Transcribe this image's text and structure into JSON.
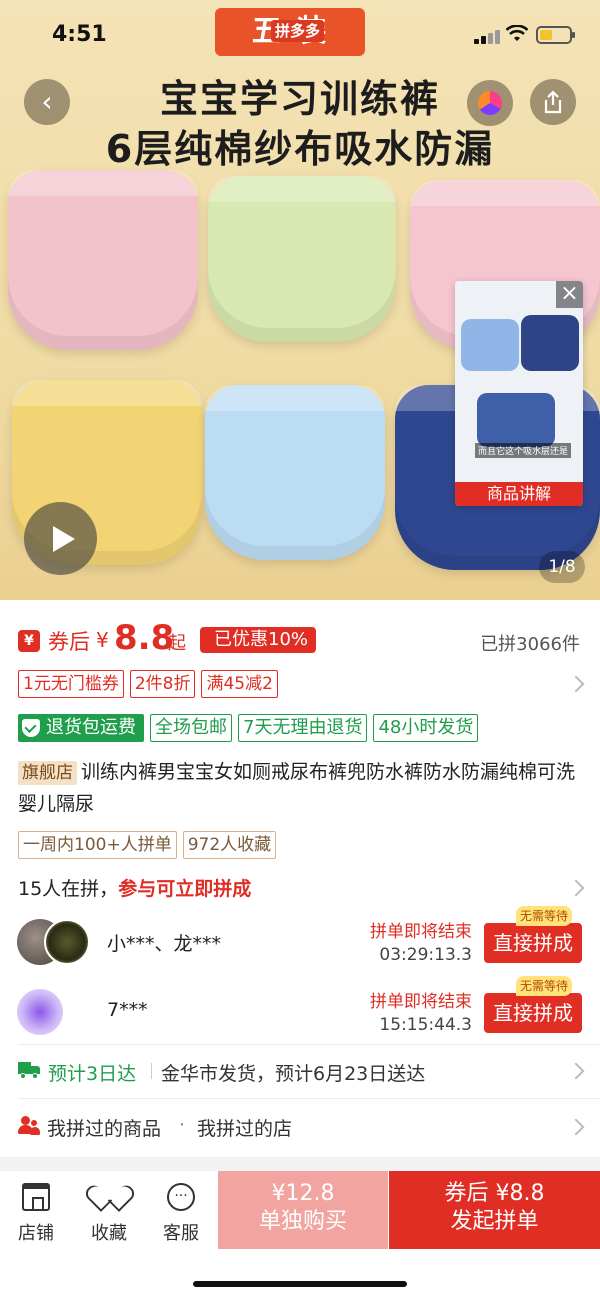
{
  "status_bar": {
    "time": "4:51"
  },
  "hero": {
    "banner_text": "五 装",
    "banner_badge": "拼多多",
    "title_line1": "宝宝学习训练裤",
    "title_line2": "6层纯棉纱布吸水防漏",
    "back_icon": "chevron-left-icon",
    "share_icon": "share-icon",
    "video_card": {
      "caption": "商品讲解",
      "close_icon": "close-icon",
      "subtitle": "而且它这个吸水层还是"
    },
    "image_counter": "1/8"
  },
  "price": {
    "coupon_icon_text": "¥",
    "after_coupon_label": "券后",
    "currency": "¥",
    "amount": "8.8",
    "suffix": "起",
    "discount_tag": "已优惠10%",
    "sold_count": "已拼3066件"
  },
  "promo_tags": [
    "1元无门槛券",
    "2件8折",
    "满45减2"
  ],
  "service_tags": {
    "main": "退货包运费",
    "others": [
      "全场包邮",
      "7天无理由退货",
      "48小时发货"
    ]
  },
  "product": {
    "store_flag": "旗舰店",
    "title": "训练内裤男宝宝女如厕戒尿布裤兜防水裤防水防漏纯棉可洗婴儿隔尿"
  },
  "stat_tags": [
    "一周内100+人拼单",
    "972人收藏"
  ],
  "group": {
    "count_text": "15人在拼，",
    "cta_text": "参与可立即拼成",
    "rows": [
      {
        "names": "小***、龙***",
        "ending": "拼单即将结束",
        "time": "03:29:13.3",
        "badge": "无需等待",
        "button": "直接拼成"
      },
      {
        "names": "7***",
        "ending": "拼单即将结束",
        "time": "15:15:44.3",
        "badge": "无需等待",
        "button": "直接拼成"
      }
    ]
  },
  "shipping": {
    "eta": "预计3日达",
    "detail": "金华市发货，预计6月23日送达"
  },
  "history": {
    "goods": "我拼过的商品",
    "dot": "·",
    "stores": "我拼过的店"
  },
  "bottom_bar": {
    "store": "店铺",
    "favorite": "收藏",
    "service": "客服",
    "solo_price": "¥12.8",
    "solo_label": "单独购买",
    "group_price": "券后 ¥8.8",
    "group_label": "发起拼单"
  },
  "colors": {
    "brand_red": "#e02e24",
    "service_green": "#1f9e4c",
    "solo_button": "#f2a4a0"
  }
}
